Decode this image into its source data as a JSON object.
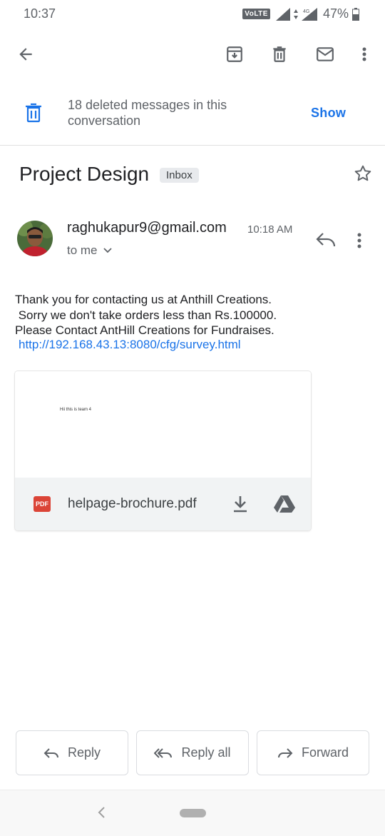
{
  "status_bar": {
    "time": "10:37",
    "volte": "VoLTE",
    "network": "4G",
    "battery": "47%"
  },
  "toolbar": {
    "icons": [
      "back-arrow-icon",
      "archive-icon",
      "delete-icon",
      "mark-unread-icon",
      "more-vert-icon"
    ]
  },
  "deleted_notice": {
    "text": "18 deleted messages in this conversation",
    "action": "Show"
  },
  "email": {
    "subject": "Project Design",
    "label": "Inbox",
    "sender": "raghukapur9@gmail.com",
    "time": "10:18 AM",
    "recipient": "to me",
    "body": "Thank you for contacting us at Anthill Creations.\n Sorry we don't take orders less than Rs.100000.\nPlease Contact AntHill Creations for Fundraises.",
    "link": "http://192.168.43.13:8080/cfg/survey.html"
  },
  "attachment": {
    "preview_text": "Hii this is team 4",
    "badge": "PDF",
    "filename": "helpage-brochure.pdf"
  },
  "actions": {
    "reply": "Reply",
    "reply_all": "Reply all",
    "forward": "Forward"
  },
  "colors": {
    "accent": "#1a73e8",
    "pdf": "#db4437",
    "icon": "#5f6368"
  }
}
